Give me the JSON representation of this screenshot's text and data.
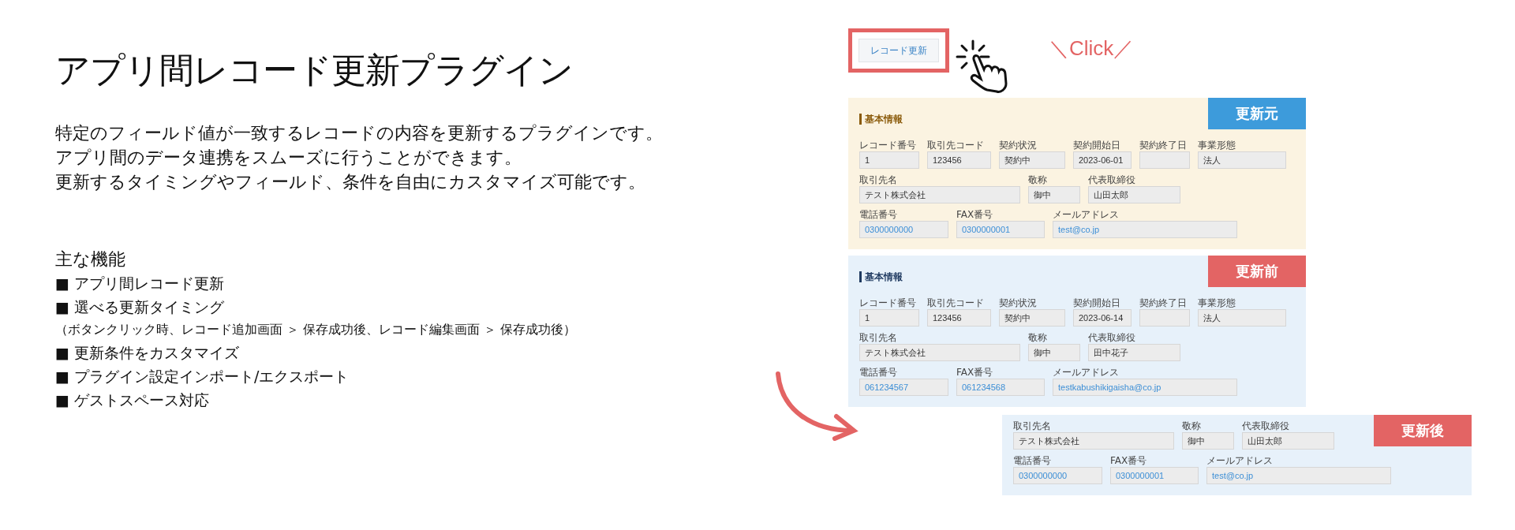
{
  "title": "アプリ間レコード更新プラグイン",
  "description": [
    "特定のフィールド値が一致するレコードの内容を更新するプラグインです。アプリ間のデータ連携をスムーズに行うことができます。",
    "更新するタイミングやフィールド、条件を自由にカスタマイズ可能です。"
  ],
  "features": {
    "heading": "主な機能",
    "items": [
      {
        "kind": "item",
        "text": "■ アプリ間レコード更新"
      },
      {
        "kind": "item",
        "text": "■ 選べる更新タイミング"
      },
      {
        "kind": "note",
        "text": "（ボタンクリック時、レコード追加画面 ＞ 保存成功後、レコード編集画面 ＞ 保存成功後）"
      },
      {
        "kind": "item",
        "text": "■ 更新条件をカスタマイズ"
      },
      {
        "kind": "item",
        "text": "■ プラグイン設定インポート/エクスポート"
      },
      {
        "kind": "item",
        "text": "■ ゲストスペース対応"
      }
    ]
  },
  "demo": {
    "update_button": "レコード更新",
    "click_label": "＼Click／",
    "panels": [
      {
        "kind": "source",
        "heading": "基本情報",
        "badge": {
          "text": "更新元",
          "color": "#3d9bdb"
        },
        "rows": [
          {
            "kind": "ids",
            "fields": [
              {
                "label": "レコード番号",
                "value": "1"
              },
              {
                "label": "取引先コード",
                "value": "123456"
              },
              {
                "label": "契約状況",
                "value": "契約中"
              },
              {
                "label": "契約開始日",
                "value": "2023-06-01"
              },
              {
                "label": "契約終了日"
              },
              {
                "label": "事業形態",
                "value": "法人"
              }
            ]
          },
          {
            "kind": "names",
            "fields": [
              {
                "label": "取引先名",
                "value": "テスト株式会社"
              },
              {
                "label": "敬称",
                "value": "御中"
              },
              {
                "label": "代表取締役",
                "value": "山田太郎"
              }
            ]
          },
          {
            "kind": "contact",
            "fields": [
              {
                "label": "電話番号",
                "value": "0300000000",
                "link": true
              },
              {
                "label": "FAX番号",
                "value": "0300000001",
                "link": true
              },
              {
                "label": "メールアドレス",
                "value": "test@co.jp",
                "link": true
              }
            ]
          }
        ]
      },
      {
        "kind": "target",
        "heading": "基本情報",
        "badge": {
          "text": "更新前",
          "color": "#e36464"
        },
        "rows": [
          {
            "kind": "ids",
            "fields": [
              {
                "label": "レコード番号",
                "value": "1"
              },
              {
                "label": "取引先コード",
                "value": "123456"
              },
              {
                "label": "契約状況",
                "value": "契約中"
              },
              {
                "label": "契約開始日",
                "value": "2023-06-14"
              },
              {
                "label": "契約終了日"
              },
              {
                "label": "事業形態",
                "value": "法人"
              }
            ]
          },
          {
            "kind": "names",
            "fields": [
              {
                "label": "取引先名",
                "value": "テスト株式会社"
              },
              {
                "label": "敬称",
                "value": "御中"
              },
              {
                "label": "代表取締役",
                "value": "田中花子"
              }
            ]
          },
          {
            "kind": "contact",
            "fields": [
              {
                "label": "電話番号",
                "value": "061234567",
                "link": true
              },
              {
                "label": "FAX番号",
                "value": "061234568",
                "link": true
              },
              {
                "label": "メールアドレス",
                "value": "testkabushikigaisha@co.jp",
                "link": true
              }
            ]
          }
        ]
      },
      {
        "kind": "target",
        "badge": {
          "text": "更新後",
          "color": "#e36464"
        },
        "rows": [
          {
            "kind": "names",
            "fields": [
              {
                "label": "取引先名",
                "value": "テスト株式会社"
              },
              {
                "label": "敬称",
                "value": "御中"
              },
              {
                "label": "代表取締役",
                "value": "山田太郎"
              }
            ]
          },
          {
            "kind": "contact",
            "fields": [
              {
                "label": "電話番号",
                "value": "0300000000",
                "link": true
              },
              {
                "label": "FAX番号",
                "value": "0300000001",
                "link": true
              },
              {
                "label": "メールアドレス",
                "value": "test@co.jp",
                "link": true
              }
            ]
          }
        ]
      }
    ]
  }
}
